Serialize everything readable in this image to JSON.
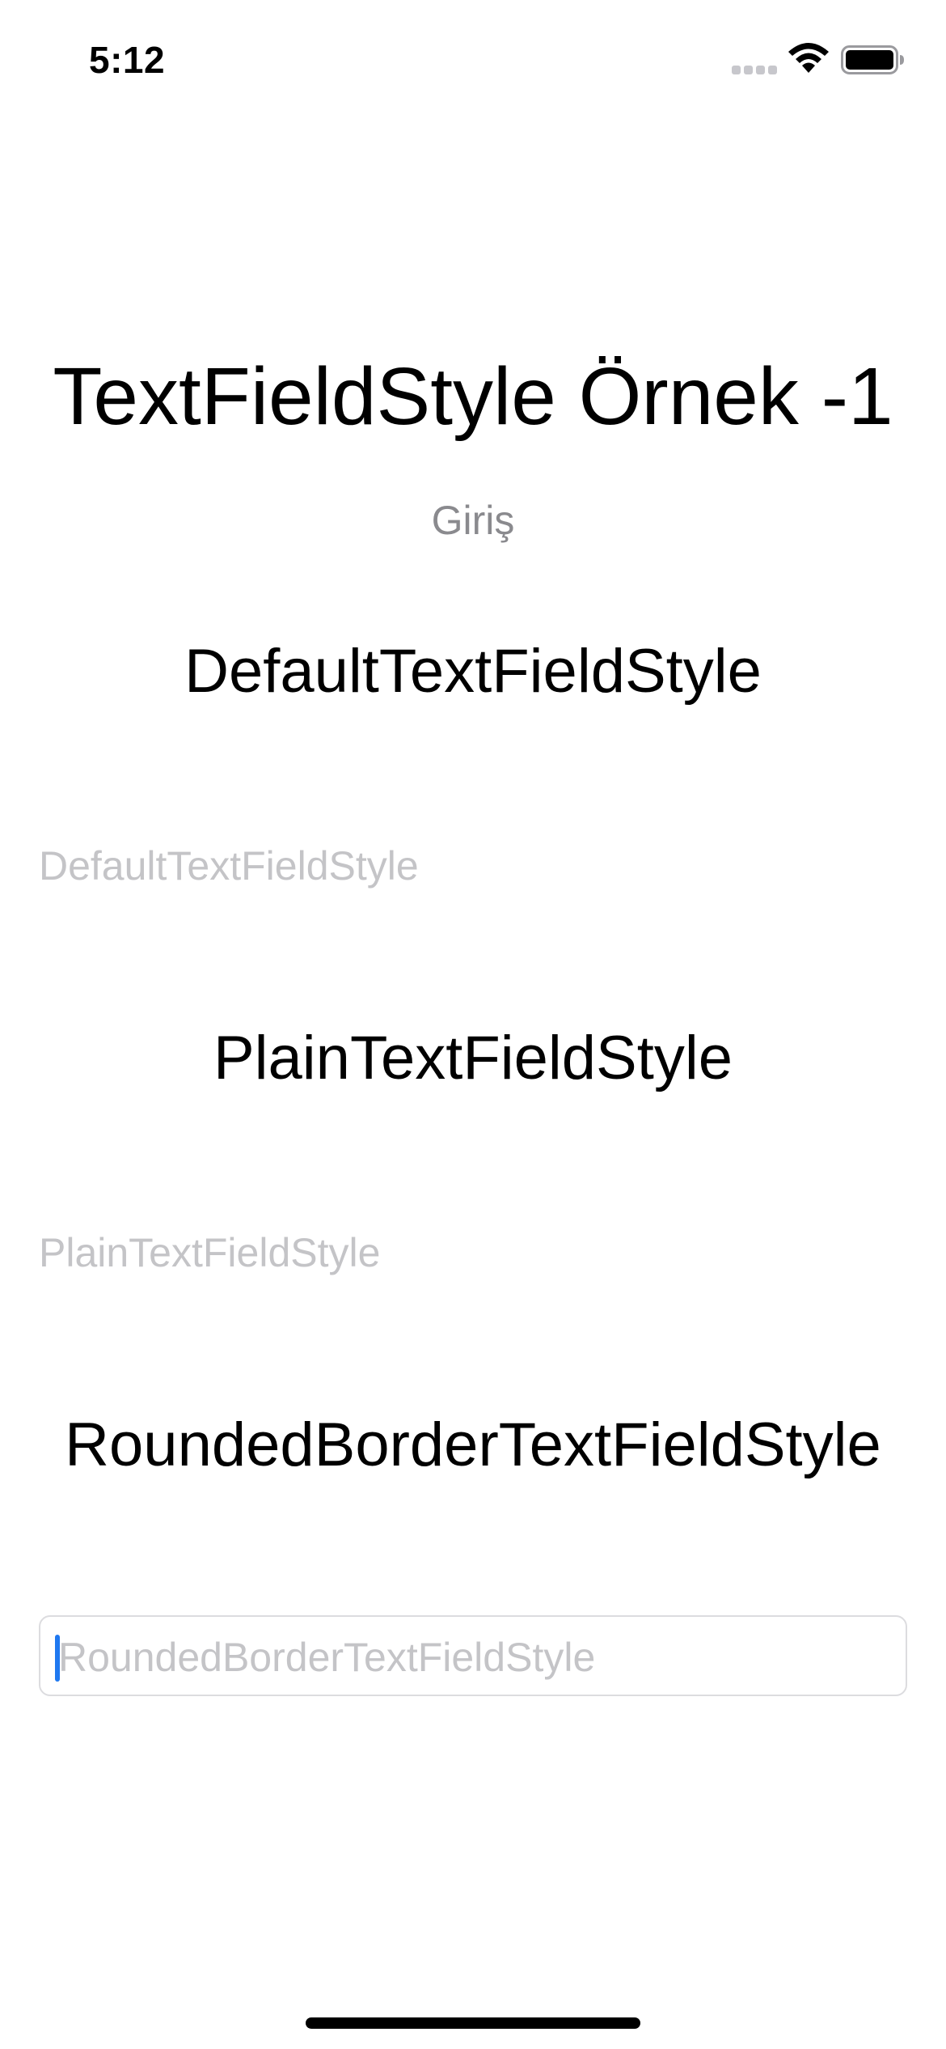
{
  "status_bar": {
    "time": "5:12",
    "icons": [
      "cellular-signal-icon",
      "wifi-icon",
      "battery-icon"
    ]
  },
  "header": {
    "title": "TextFieldStyle Örnek -1",
    "subtitle": "Giriş"
  },
  "sections": [
    {
      "heading": "DefaultTextFieldStyle",
      "field": {
        "placeholder": "DefaultTextFieldStyle",
        "value": ""
      }
    },
    {
      "heading": "PlainTextFieldStyle",
      "field": {
        "placeholder": "PlainTextFieldStyle",
        "value": ""
      }
    },
    {
      "heading": "RoundedBorderTextFieldStyle",
      "field": {
        "placeholder": "RoundedBorderTextFieldStyle",
        "value": "",
        "focused": true
      }
    }
  ],
  "colors": {
    "background": "#ffffff",
    "text": "#000000",
    "subtitle": "#8a8a8e",
    "placeholder": "#c4c4c7",
    "caret": "#1f78f0",
    "border": "#dcdcdf"
  }
}
